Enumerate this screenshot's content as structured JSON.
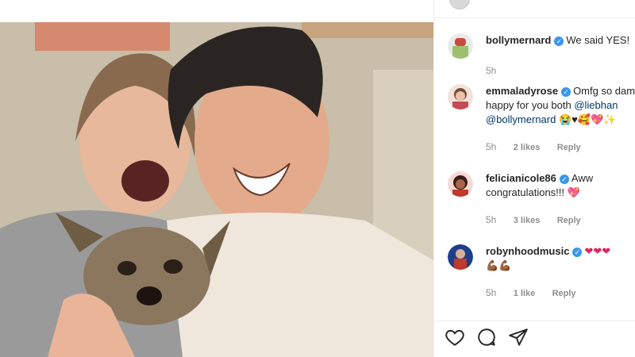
{
  "post": {
    "caption": {
      "username": "bollymernard",
      "text": "We said YES!",
      "time": "5h"
    },
    "comments": [
      {
        "username": "emmaladyrose",
        "text_a": "Omfg so dam",
        "text_b": "happy for you both ",
        "mention1": "@liebhan",
        "mention2": "@bollymernard",
        "emojis": "😭♥🥰💖✨",
        "time": "5h",
        "likes": "2 likes",
        "reply": "Reply"
      },
      {
        "username": "felicianicole86",
        "text": "Aww congratulations!!! ",
        "emojis": "💖",
        "time": "5h",
        "likes": "3 likes",
        "reply": "Reply"
      },
      {
        "username": "robynhoodmusic",
        "emojis": "❤❤❤",
        "emojis2": "💪🏾💪🏾",
        "time": "5h",
        "likes": "1 like",
        "reply": "Reply"
      }
    ]
  },
  "icons": {
    "like": "heart-outline-icon",
    "comment": "comment-bubble-icon",
    "share": "paper-plane-icon",
    "verified": "verified-badge-icon"
  },
  "colors": {
    "verified": "#3897f0",
    "mention": "#00376b",
    "meta": "#8e8e8e"
  }
}
